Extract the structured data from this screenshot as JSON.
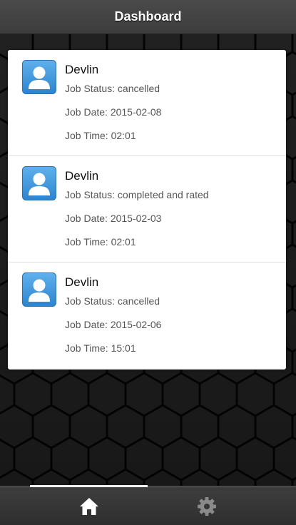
{
  "header": {
    "title": "Dashboard"
  },
  "jobs": [
    {
      "name": "Devlin",
      "status": "Job Status: cancelled",
      "date": "Job Date: 2015-02-08",
      "time": "Job Time: 02:01"
    },
    {
      "name": "Devlin",
      "status": "Job Status: completed and rated",
      "date": "Job Date: 2015-02-03",
      "time": "Job Time: 02:01"
    },
    {
      "name": "Devlin",
      "status": "Job Status: cancelled",
      "date": "Job Date: 2015-02-06",
      "time": "Job Time: 15:01"
    }
  ],
  "footer": {
    "tabs": [
      {
        "icon": "home-icon",
        "active": true
      },
      {
        "icon": "gear-icon",
        "active": false
      }
    ]
  },
  "colors": {
    "header_bg": "#444444",
    "card_bg": "#ffffff",
    "avatar_blue": "#3d97dc",
    "footer_bg": "#333333",
    "active_indicator": "#f2f2f2",
    "inactive_icon": "#8a8a8a"
  }
}
